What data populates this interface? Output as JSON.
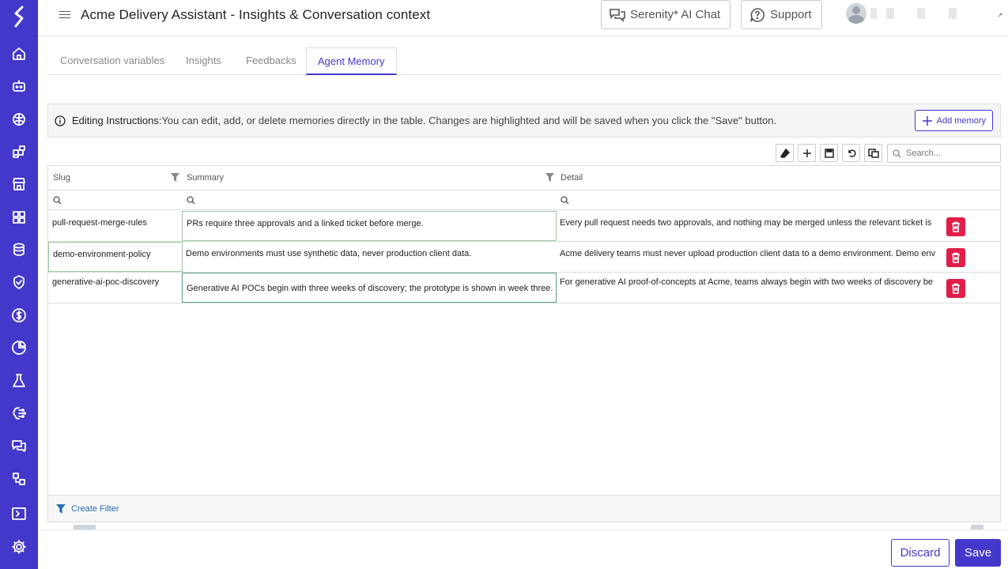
{
  "app": {
    "title": "Acme Delivery Assistant - Insights & Conversation context",
    "brand_color": "#4338ca"
  },
  "header": {
    "ai_chat_label": "Serenity* AI Chat",
    "support_label": "Support"
  },
  "sidebar": {
    "items": [
      {
        "icon": "home-icon"
      },
      {
        "icon": "bot-icon"
      },
      {
        "icon": "brain-icon"
      },
      {
        "icon": "puzzle-icon"
      },
      {
        "icon": "store-icon"
      },
      {
        "icon": "apps-icon"
      },
      {
        "icon": "database-icon"
      },
      {
        "icon": "shield-check-icon"
      },
      {
        "icon": "dollar-icon"
      },
      {
        "icon": "pie-chart-icon"
      },
      {
        "icon": "flask-icon"
      },
      {
        "icon": "brain-circuit-icon"
      },
      {
        "icon": "chat-icon"
      },
      {
        "icon": "workflow-icon"
      },
      {
        "icon": "terminal-icon"
      },
      {
        "icon": "settings-icon"
      }
    ]
  },
  "tabs": [
    {
      "label": "Conversation variables",
      "active": false
    },
    {
      "label": "Insights",
      "active": false
    },
    {
      "label": "Feedbacks",
      "active": false
    },
    {
      "label": "Agent Memory",
      "active": true
    }
  ],
  "info": {
    "heading": "Editing Instructions:",
    "text": "You can edit, add, or delete memories directly in the table. Changes are highlighted and will be saved when you click the \"Save\" button.",
    "add_memory_label": "Add memory"
  },
  "toolbar": {
    "search_placeholder": "Search..."
  },
  "grid": {
    "columns": [
      "Slug",
      "Summary",
      "Detail"
    ],
    "rows": [
      {
        "slug": "pull-request-merge-rules",
        "summary": "PRs require three approvals and a linked ticket before merge.",
        "detail": "Every pull request needs two approvals, and nothing may be merged unless the relevant ticket is"
      },
      {
        "slug": "demo-environment-policy",
        "summary": "Demo environments must use synthetic data, never production client data.",
        "detail": "Acme delivery teams must never upload production client data to a demo environment. Demo env"
      },
      {
        "slug": "generative-ai-poc-discovery",
        "summary": "Generative AI POCs begin with three weeks of discovery; the prototype is shown in week three.",
        "detail": "For generative AI proof-of-concepts at Acme, teams always begin with two weeks of discovery be"
      }
    ],
    "create_filter_label": "Create Filter"
  },
  "actions": {
    "discard_label": "Discard",
    "save_label": "Save"
  }
}
